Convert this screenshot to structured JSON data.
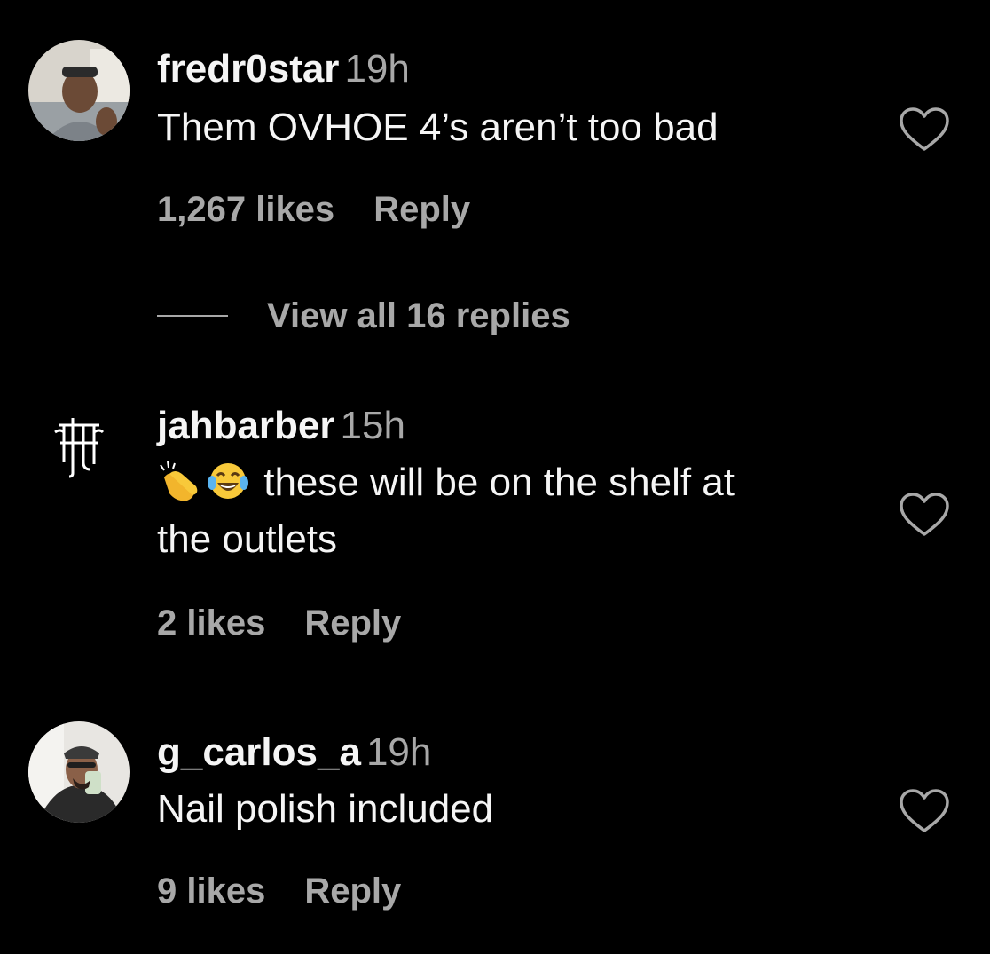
{
  "comments": [
    {
      "username": "fredr0star",
      "time": "19h",
      "text": "Them OVHOE 4’s aren’t too bad",
      "likes": "1,267 likes",
      "reply": "Reply",
      "avatar_icon": "profile-photo"
    },
    {
      "username": "jahbarber",
      "time": "15h",
      "emojis": [
        "clapping-hands",
        "tears-of-joy"
      ],
      "text": "these will be on the shelf at",
      "text_line2": "the outlets",
      "likes": "2 likes",
      "reply": "Reply",
      "avatar_icon": "monogram-logo"
    },
    {
      "username": "g_carlos_a",
      "time": "19h",
      "text": "Nail polish included",
      "likes": "9 likes",
      "reply": "Reply",
      "avatar_icon": "profile-photo"
    }
  ],
  "view_replies": {
    "label": "View all 16 replies"
  },
  "colors": {
    "background": "#000000",
    "primary_text": "#f5f5f5",
    "secondary_text": "#a8a8a8"
  }
}
